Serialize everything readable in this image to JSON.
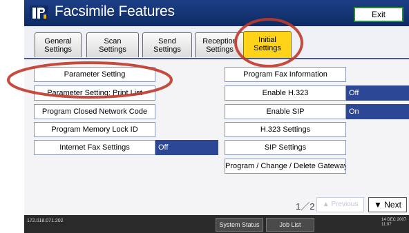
{
  "header": {
    "title": "Facsimile Features",
    "exit_label": "Exit"
  },
  "tabs": [
    {
      "line1": "General",
      "line2": "Settings"
    },
    {
      "line1": "Scan",
      "line2": "Settings"
    },
    {
      "line1": "Send",
      "line2": "Settings"
    },
    {
      "line1": "Reception",
      "line2": "Settings"
    },
    {
      "line1": "Initial",
      "line2": "Settings"
    }
  ],
  "left_items": [
    {
      "label": "Parameter Setting"
    },
    {
      "label": "Parameter Setting: Print List"
    },
    {
      "label": "Program Closed Network Code"
    },
    {
      "label": "Program Memory Lock ID"
    },
    {
      "label": "Internet Fax Settings",
      "value": "Off"
    }
  ],
  "right_items": [
    {
      "label": "Program Fax Information"
    },
    {
      "label": "Enable H.323",
      "value": "Off"
    },
    {
      "label": "Enable SIP",
      "value": "On"
    },
    {
      "label": "H.323 Settings"
    },
    {
      "label": "SIP Settings"
    },
    {
      "label": "Program / Change / Delete Gateway"
    }
  ],
  "pagination": {
    "page_indicator": "1／2",
    "prev_label": "▲ Previous",
    "next_label": "▼ Next"
  },
  "status_bar": {
    "ip": "172.018.071.202",
    "system_status_label": "System Status",
    "job_list_label": "Job List",
    "date": "14 DEC 2007",
    "time": "11:07"
  },
  "colors": {
    "title_bar": "#0c2a64",
    "active_tab": "#ffd318",
    "value_box": "#2b4796",
    "annotation": "#c0392b"
  },
  "icons": {
    "logo": "facsimile-logo-icon",
    "annotation": "red-oval-highlight"
  }
}
